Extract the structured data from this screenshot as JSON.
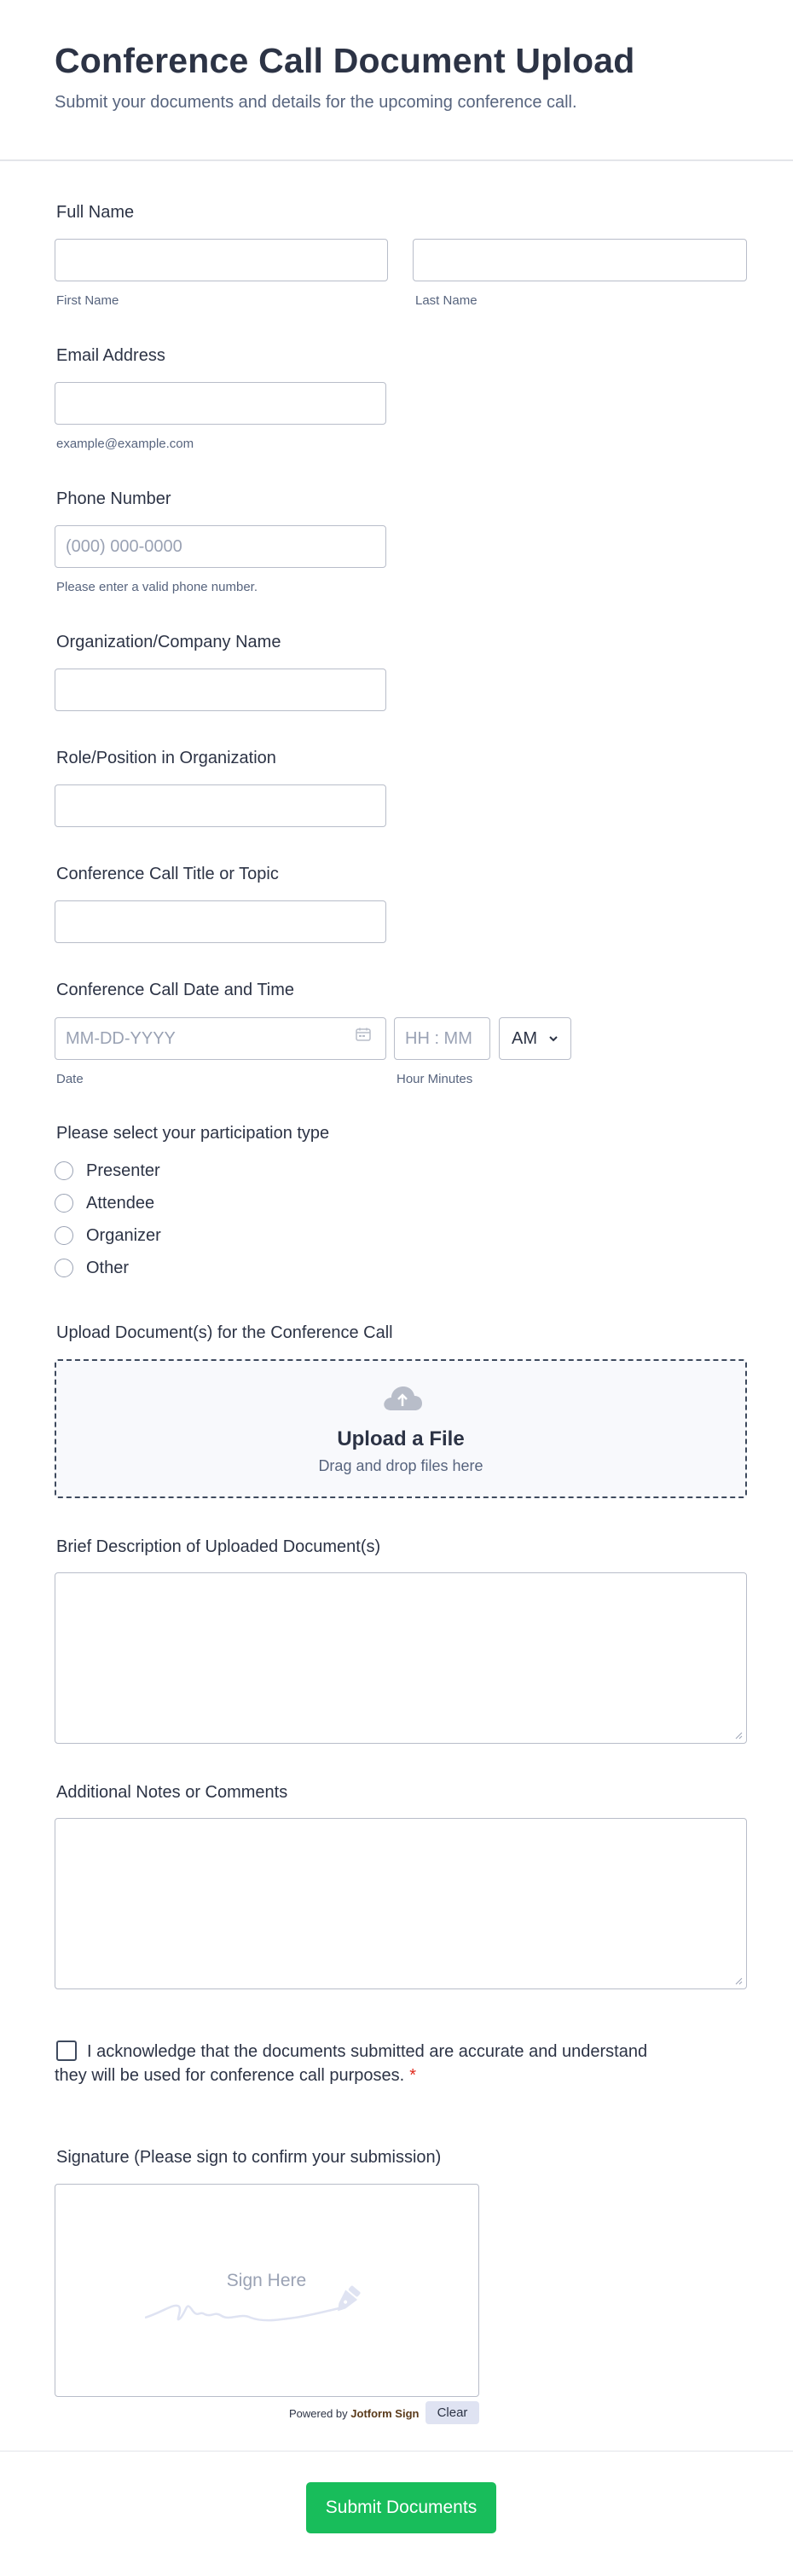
{
  "header": {
    "title": "Conference Call Document Upload",
    "subtitle": "Submit your documents and details for the upcoming conference call."
  },
  "full_name": {
    "label": "Full Name",
    "first_sublabel": "First Name",
    "last_sublabel": "Last Name",
    "first_value": "",
    "last_value": ""
  },
  "email": {
    "label": "Email Address",
    "sublabel": "example@example.com",
    "value": ""
  },
  "phone": {
    "label": "Phone Number",
    "placeholder": "(000) 000-0000",
    "sublabel": "Please enter a valid phone number."
  },
  "organization": {
    "label": "Organization/Company Name",
    "value": ""
  },
  "role": {
    "label": "Role/Position in Organization",
    "value": ""
  },
  "topic": {
    "label": "Conference Call Title or Topic",
    "value": ""
  },
  "datetime": {
    "label": "Conference Call Date and Time",
    "date_placeholder": "MM-DD-YYYY",
    "date_sublabel": "Date",
    "time_placeholder": "HH : MM",
    "time_sublabel": "Hour Minutes",
    "ampm_value": "AM",
    "calendar_icon": "calendar-icon",
    "chevron_icon": "chevron-down-icon"
  },
  "participation": {
    "label": "Please select your participation type",
    "options": [
      "Presenter",
      "Attendee",
      "Organizer",
      "Other"
    ]
  },
  "upload": {
    "label": "Upload Document(s) for the Conference Call",
    "title": "Upload a File",
    "subtitle": "Drag and drop files here",
    "icon": "cloud-upload-icon"
  },
  "description": {
    "label": "Brief Description of Uploaded Document(s)",
    "value": ""
  },
  "notes": {
    "label": "Additional Notes or Comments",
    "value": ""
  },
  "acknowledge": {
    "text": "I acknowledge that the documents submitted are accurate and understand they will be used for conference call purposes.",
    "required_mark": "*"
  },
  "signature": {
    "label": "Signature (Please sign to confirm your submission)",
    "placeholder": "Sign Here",
    "powered_prefix": "Powered by",
    "powered_brand": "Jotform Sign",
    "clear_label": "Clear"
  },
  "submit": {
    "label": "Submit Documents"
  },
  "colors": {
    "text": "#2c3345",
    "muted": "#57647e",
    "border": "#b8bdc9",
    "submit_green": "#18bd5b",
    "required_red": "#e0291c",
    "clear_bg": "#dfe3f2"
  }
}
